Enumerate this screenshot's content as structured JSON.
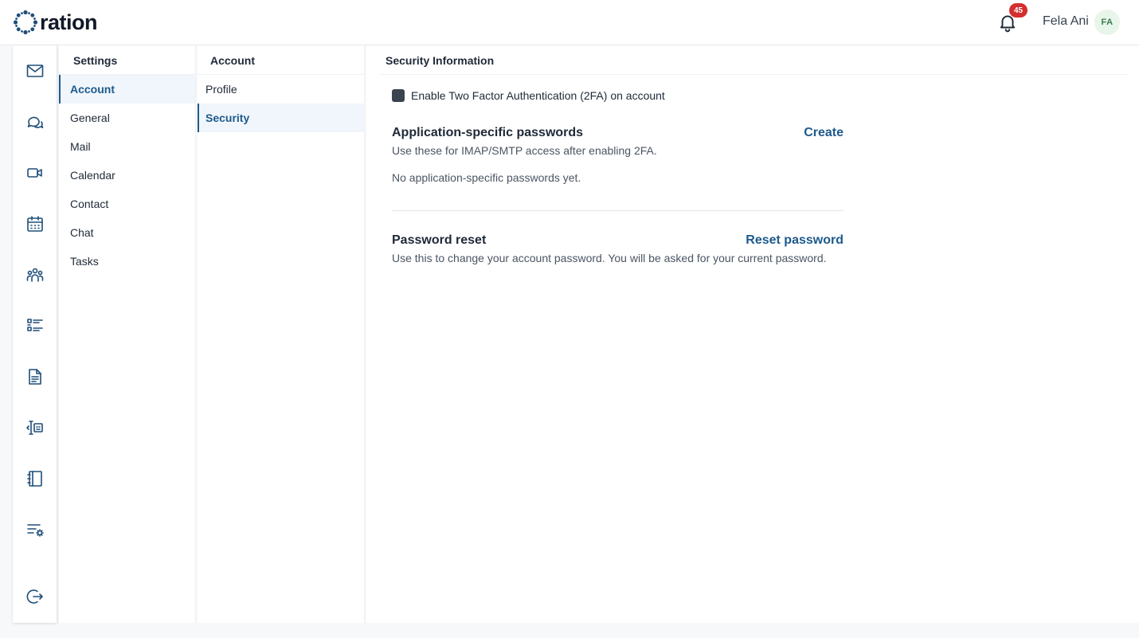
{
  "brand": {
    "name": "ration",
    "accent": "#1e5a8c"
  },
  "header": {
    "notifications": {
      "count": "45",
      "icon": "bell-icon"
    },
    "user": {
      "name": "Fela Ani",
      "initials": "FA"
    }
  },
  "rail": {
    "icons": [
      "mail-icon",
      "chat-icon",
      "video-icon",
      "calendar-icon",
      "contacts-icon",
      "tasks-icon",
      "document-icon",
      "code-review-icon",
      "notebook-icon",
      "settings-list-icon",
      "logout-icon"
    ]
  },
  "settings": {
    "title": "Settings",
    "items": [
      "Account",
      "General",
      "Mail",
      "Calendar",
      "Contact",
      "Chat",
      "Tasks"
    ]
  },
  "account": {
    "title": "Account",
    "items": [
      "Profile",
      "Security"
    ]
  },
  "security": {
    "title": "Security Information",
    "tfa_label": "Enable Two Factor Authentication (2FA) on account",
    "app_passwords": {
      "title": "Application-specific passwords",
      "description": "Use these for IMAP/SMTP access after enabling 2FA.",
      "empty": "No application-specific passwords yet.",
      "action": "Create"
    },
    "password_reset": {
      "title": "Password reset",
      "description": "Use this to change your account password. You will be asked for your current password.",
      "action": "Reset password"
    }
  }
}
